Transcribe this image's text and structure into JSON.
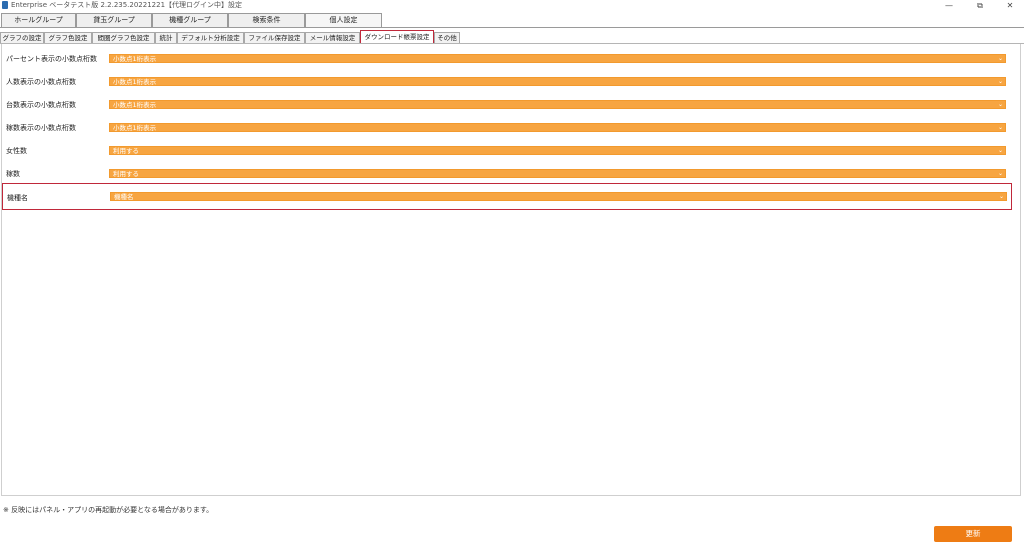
{
  "window": {
    "title": "Enterprise ベータテスト版 2.2.235.20221221【代理ログイン中】設定",
    "minimize_glyph": "—",
    "maximize_glyph": "⧉",
    "close_glyph": "✕"
  },
  "main_tabs": [
    {
      "label": "ホールグループ"
    },
    {
      "label": "貸玉グループ"
    },
    {
      "label": "機種グループ"
    },
    {
      "label": "検索条件"
    },
    {
      "label": "個人設定"
    }
  ],
  "sub_tabs": [
    {
      "label": "グラフの設定"
    },
    {
      "label": "グラフ色設定"
    },
    {
      "label": "間圏グラフ色設定"
    },
    {
      "label": "統計"
    },
    {
      "label": "デフォルト分析設定"
    },
    {
      "label": "ファイル保存設定"
    },
    {
      "label": "メール情報設定"
    },
    {
      "label": "ダウンロード帳票設定"
    },
    {
      "label": "その他"
    }
  ],
  "settings": [
    {
      "label": "パーセント表示の小数点桁数",
      "value": "小数点1桁表示"
    },
    {
      "label": "人数表示の小数点桁数",
      "value": "小数点1桁表示"
    },
    {
      "label": "台数表示の小数点桁数",
      "value": "小数点1桁表示"
    },
    {
      "label": "稼数表示の小数点桁数",
      "value": "小数点1桁表示"
    },
    {
      "label": "女性数",
      "value": "利用する"
    },
    {
      "label": "稼数",
      "value": "利用する"
    },
    {
      "label": "機種名",
      "value": "機種名"
    }
  ],
  "footer": {
    "note": "※ 反映にはパネル・アプリの再起動が必要となる場合があります。",
    "update_label": "更新"
  },
  "colors": {
    "accent_orange": "#f7a541",
    "button_orange": "#ee7c14",
    "highlight_red": "#c0283a"
  },
  "icons": {
    "dropdown": "chevron-down-icon"
  }
}
